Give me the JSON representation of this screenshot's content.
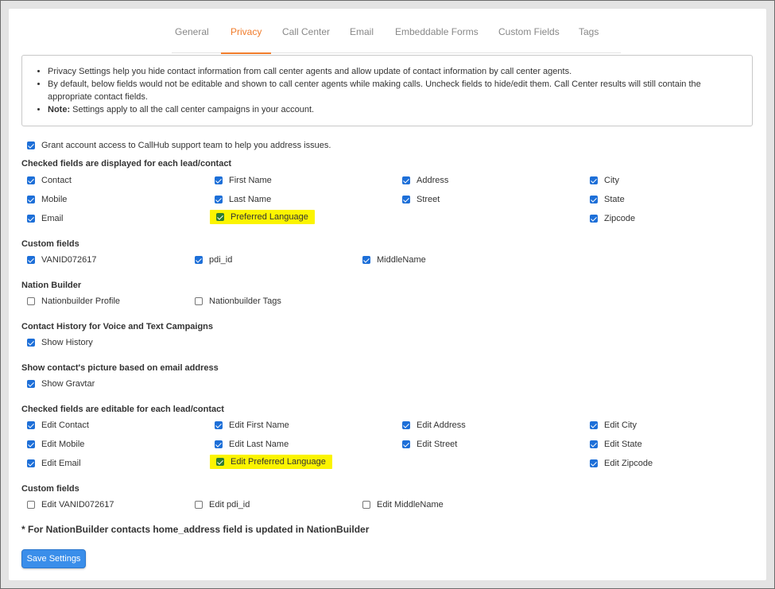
{
  "tabs": [
    "General",
    "Privacy",
    "Call Center",
    "Email",
    "Embeddable Forms",
    "Custom Fields",
    "Tags"
  ],
  "active_tab": "Privacy",
  "info": {
    "line1": "Privacy Settings help you hide contact information from call center agents and allow update of contact information by call center agents.",
    "line2": "By default, below fields would not be editable and shown to call center agents while making calls. Uncheck fields to hide/edit them. Call Center results will still contain the appropriate contact fields.",
    "note_label": "Note:",
    "note_text": " Settings apply to all the call center campaigns in your account."
  },
  "grant_access": {
    "label": "Grant account access to CallHub support team to help you address issues.",
    "checked": true
  },
  "displayed": {
    "heading": "Checked fields are displayed for each lead/contact",
    "fields": {
      "contact": "Contact",
      "mobile": "Mobile",
      "email": "Email",
      "first_name": "First Name",
      "last_name": "Last Name",
      "preferred_language": "Preferred Language",
      "address": "Address",
      "street": "Street",
      "city": "City",
      "state": "State",
      "zipcode": "Zipcode"
    }
  },
  "custom_fields": {
    "heading": "Custom fields",
    "fields": {
      "vanid": "VANID072617",
      "pdi_id": "pdi_id",
      "middle_name": "MiddleName"
    }
  },
  "nation_builder": {
    "heading": "Nation Builder",
    "profile": "Nationbuilder Profile",
    "tags": "Nationbuilder Tags"
  },
  "contact_history": {
    "heading": "Contact History for Voice and Text Campaigns",
    "label": "Show History"
  },
  "gravatar": {
    "heading": "Show contact's picture based on email address",
    "label": "Show Gravtar"
  },
  "editable": {
    "heading": "Checked fields are editable for each lead/contact",
    "fields": {
      "contact": "Edit Contact",
      "mobile": "Edit Mobile",
      "email": "Edit Email",
      "first_name": "Edit First Name",
      "last_name": "Edit Last Name",
      "preferred_language": "Edit Preferred Language",
      "address": "Edit Address",
      "street": "Edit Street",
      "city": "Edit City",
      "state": "Edit State",
      "zipcode": "Edit Zipcode"
    }
  },
  "edit_custom_fields": {
    "heading": "Custom fields",
    "fields": {
      "vanid": "Edit VANID072617",
      "pdi_id": "Edit pdi_id",
      "middle_name": "Edit MiddleName"
    }
  },
  "footnote": "* For NationBuilder contacts home_address field is updated in NationBuilder",
  "save_label": "Save Settings",
  "colors": {
    "accent": "#f07c2b",
    "checkbox": "#1d6fd8",
    "highlight": "#fbf400",
    "button": "#3a8eea"
  }
}
